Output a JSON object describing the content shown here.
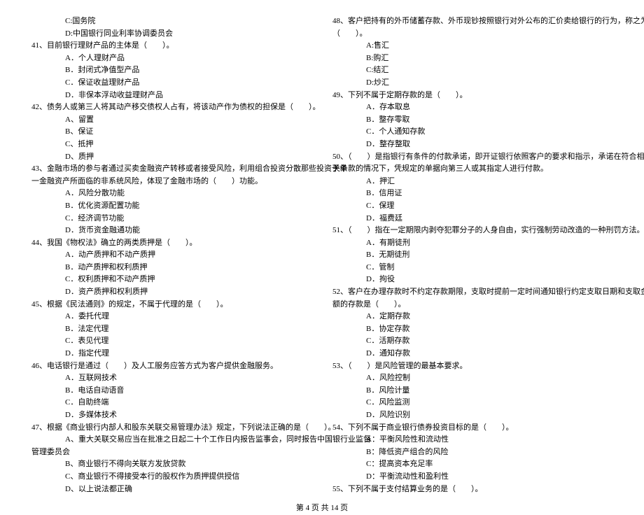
{
  "left": [
    {
      "cls": "indent-opt",
      "t": "C:国务院"
    },
    {
      "cls": "indent-opt",
      "t": "D:中国银行同业利率协调委员会"
    },
    {
      "cls": "indent-q",
      "t": "41、目前银行理财产品的主体是（　　）。"
    },
    {
      "cls": "indent-opt",
      "t": "A．个人理财产品"
    },
    {
      "cls": "indent-opt",
      "t": "B．封闭式净值型产品"
    },
    {
      "cls": "indent-opt",
      "t": "C．保证收益理财产品"
    },
    {
      "cls": "indent-opt",
      "t": "D．非保本浮动收益理财产品"
    },
    {
      "cls": "indent-q",
      "t": "42、债务人或第三人将其动产移交债权人占有，将该动产作为债权的担保是（　　）。"
    },
    {
      "cls": "indent-opt",
      "t": "A、留置"
    },
    {
      "cls": "indent-opt",
      "t": "B、保证"
    },
    {
      "cls": "indent-opt",
      "t": "C、抵押"
    },
    {
      "cls": "indent-opt",
      "t": "D、质押"
    },
    {
      "cls": "indent-q",
      "t": "43、金融市场的参与者通过买卖金融资产转移或者接受风险，利用组合投资分散那些投资于单"
    },
    {
      "cls": "indent-q",
      "t": "一金融资产所面临的非系统风险，体现了金融市场的（　　）功能。"
    },
    {
      "cls": "indent-opt",
      "t": "A．风险分散功能"
    },
    {
      "cls": "indent-opt",
      "t": "B．优化资源配置功能"
    },
    {
      "cls": "indent-opt",
      "t": "C．经济调节功能"
    },
    {
      "cls": "indent-opt",
      "t": "D．货币资金融通功能"
    },
    {
      "cls": "indent-q",
      "t": "44、我国《物权法》确立的两类质押是（　　）。"
    },
    {
      "cls": "indent-opt",
      "t": "A．动产质押和不动产质押"
    },
    {
      "cls": "indent-opt",
      "t": "B．动产质押和权利质押"
    },
    {
      "cls": "indent-opt",
      "t": "C．权利质押和不动产质押"
    },
    {
      "cls": "indent-opt",
      "t": "D．资产质押和权利质押"
    },
    {
      "cls": "indent-q",
      "t": "45、根据《民法通则》的规定，不属于代理的是（　　）。"
    },
    {
      "cls": "indent-opt",
      "t": "A．委托代理"
    },
    {
      "cls": "indent-opt",
      "t": "B．法定代理"
    },
    {
      "cls": "indent-opt",
      "t": "C．表见代理"
    },
    {
      "cls": "indent-opt",
      "t": "D．指定代理"
    },
    {
      "cls": "indent-q",
      "t": "46、电话银行是通过（　　）及人工服务应答方式为客户提供金融服务。"
    },
    {
      "cls": "indent-opt",
      "t": "A．互联网技术"
    },
    {
      "cls": "indent-opt",
      "t": "B．电话自动语音"
    },
    {
      "cls": "indent-opt",
      "t": "C．自助终端"
    },
    {
      "cls": "indent-opt",
      "t": "D．多媒体技术"
    },
    {
      "cls": "indent-q",
      "t": "47、根据《商业银行内部人和股东关联交易管理办法》规定，下列说法正确的是（　　）。"
    },
    {
      "cls": "indent-opt",
      "t": "A、重大关联交易应当在批准之日起二十个工作日内报告监事会，同时报告中国银行业监督"
    },
    {
      "cls": "indent-q",
      "t": "管理委员会"
    },
    {
      "cls": "indent-opt",
      "t": "B、商业银行不得向关联方发放贷款"
    },
    {
      "cls": "indent-opt",
      "t": "C、商业银行不得接受本行的股权作为质押提供授信"
    },
    {
      "cls": "indent-opt",
      "t": "D、以上说法都正确"
    }
  ],
  "right": [
    {
      "cls": "indent-q",
      "t": "48、客户把持有的外币储蓄存款、外币现钞按照银行对外公布的汇价卖给银行的行为，称之为"
    },
    {
      "cls": "indent-q",
      "t": "（　　）。"
    },
    {
      "cls": "indent-opt",
      "t": "A:售汇"
    },
    {
      "cls": "indent-opt",
      "t": "B:购汇"
    },
    {
      "cls": "indent-opt",
      "t": "C:结汇"
    },
    {
      "cls": "indent-opt",
      "t": "D:炒汇"
    },
    {
      "cls": "indent-q",
      "t": "49、下列不属于定期存款的是（　　）。"
    },
    {
      "cls": "indent-opt",
      "t": "A．存本取息"
    },
    {
      "cls": "indent-opt",
      "t": "B．整存零取"
    },
    {
      "cls": "indent-opt",
      "t": "C．个人通知存款"
    },
    {
      "cls": "indent-opt",
      "t": "D．整存整取"
    },
    {
      "cls": "indent-q",
      "t": "50、（　　）是指银行有条件的付款承诺，即开证银行依照客户的要求和指示，承诺在符合相"
    },
    {
      "cls": "indent-q",
      "t": "关条款的情况下，凭规定的单据向第三人或其指定人进行付款。"
    },
    {
      "cls": "indent-opt",
      "t": "A．押汇"
    },
    {
      "cls": "indent-opt",
      "t": "B．信用证"
    },
    {
      "cls": "indent-opt",
      "t": "C．保理"
    },
    {
      "cls": "indent-opt",
      "t": "D．福费廷"
    },
    {
      "cls": "indent-q",
      "t": "51、（　　）指在一定期限内剥夺犯罪分子的人身自由，实行强制劳动改造的一种刑罚方法。"
    },
    {
      "cls": "indent-opt",
      "t": "A．有期徒刑"
    },
    {
      "cls": "indent-opt",
      "t": "B．无期徒刑"
    },
    {
      "cls": "indent-opt",
      "t": "C．管制"
    },
    {
      "cls": "indent-opt",
      "t": "D．拘役"
    },
    {
      "cls": "indent-q",
      "t": "52、客户在办理存款时不约定存款期限，支取时提前一定时间通知银行约定支取日期和支取金"
    },
    {
      "cls": "indent-q",
      "t": "额的存款是（　　）。"
    },
    {
      "cls": "indent-opt",
      "t": "A．定期存款"
    },
    {
      "cls": "indent-opt",
      "t": "B．协定存款"
    },
    {
      "cls": "indent-opt",
      "t": "C．活期存款"
    },
    {
      "cls": "indent-opt",
      "t": "D．通知存款"
    },
    {
      "cls": "indent-q",
      "t": "53、（　　）是风险管理的最基本要求。"
    },
    {
      "cls": "indent-opt",
      "t": "A．风险控制"
    },
    {
      "cls": "indent-opt",
      "t": "B．风险计量"
    },
    {
      "cls": "indent-opt",
      "t": "C．风险监测"
    },
    {
      "cls": "indent-opt",
      "t": "D．风险识别"
    },
    {
      "cls": "indent-q",
      "t": "54、下列不属于商业银行债券投资目标的是（　　）。"
    },
    {
      "cls": "indent-opt",
      "t": "A：平衡风险性和流动性"
    },
    {
      "cls": "indent-opt",
      "t": "B：降低资产组合的风险"
    },
    {
      "cls": "indent-opt",
      "t": "C：提高资本充足率"
    },
    {
      "cls": "indent-opt",
      "t": "D：平衡流动性和盈利性"
    },
    {
      "cls": "indent-q",
      "t": "55、下列不属于支付结算业务的是（　　）。"
    }
  ],
  "footer": "第 4 页 共 14 页"
}
